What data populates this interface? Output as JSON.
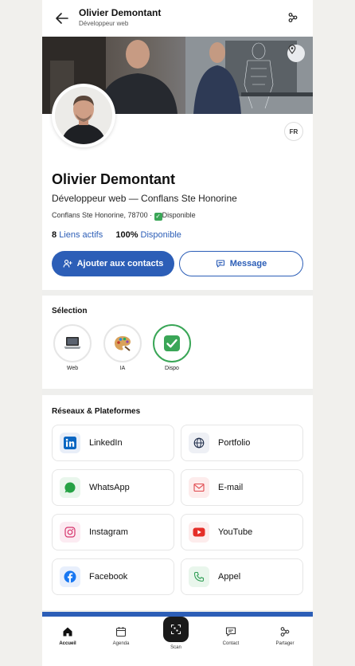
{
  "header": {
    "name": "Olivier Demontant",
    "subtitle": "Développeur web",
    "back_icon": "arrow-left-icon",
    "share_icon": "share-icon"
  },
  "banner": {
    "location_icon": "map-pin-icon"
  },
  "profile": {
    "language": "FR",
    "name": "Olivier Demontant",
    "role": "Développeur web — Conflans Ste Honorine",
    "location": "Conflans Ste Honorine, 78700 · ",
    "availability": "Disponible",
    "stats": {
      "links_count": "8",
      "links_label": "Liens actifs",
      "availability_pct": "100%",
      "availability_label": "Disponible"
    },
    "add_button": "Ajouter aux contacts",
    "message_button": "Message",
    "accent_color": "#2c5eb7"
  },
  "selection": {
    "title": "Sélection",
    "items": [
      {
        "label": "Web",
        "icon": "laptop-icon",
        "active": false
      },
      {
        "label": "IA",
        "icon": "palette-icon",
        "active": false
      },
      {
        "label": "Dispo",
        "icon": "check-mark-icon",
        "active": true
      }
    ]
  },
  "networks": {
    "title": "Réseaux & Plateformes",
    "items": [
      {
        "label": "LinkedIn",
        "icon": "linkedin-icon",
        "color": "#0a66c2"
      },
      {
        "label": "Portfolio",
        "icon": "globe-icon",
        "color": "#1f2d4a"
      },
      {
        "label": "WhatsApp",
        "icon": "whatsapp-icon",
        "color": "#25a244"
      },
      {
        "label": "E-mail",
        "icon": "mail-icon",
        "color": "#e0474c"
      },
      {
        "label": "Instagram",
        "icon": "instagram-icon",
        "color": "#d6336c"
      },
      {
        "label": "YouTube",
        "icon": "youtube-icon",
        "color": "#e52d27"
      },
      {
        "label": "Facebook",
        "icon": "facebook-icon",
        "color": "#1877f2"
      },
      {
        "label": "Appel",
        "icon": "phone-icon",
        "color": "#2f9e55"
      }
    ]
  },
  "bottom_nav": {
    "items": [
      {
        "label": "Accueil",
        "icon": "home-icon",
        "active": true
      },
      {
        "label": "Agenda",
        "icon": "calendar-icon",
        "active": false
      },
      {
        "label": "Scan",
        "icon": "qr-scan-icon",
        "active": false
      },
      {
        "label": "Contact",
        "icon": "chat-icon",
        "active": false
      },
      {
        "label": "Partager",
        "icon": "share-icon",
        "active": false
      }
    ]
  }
}
